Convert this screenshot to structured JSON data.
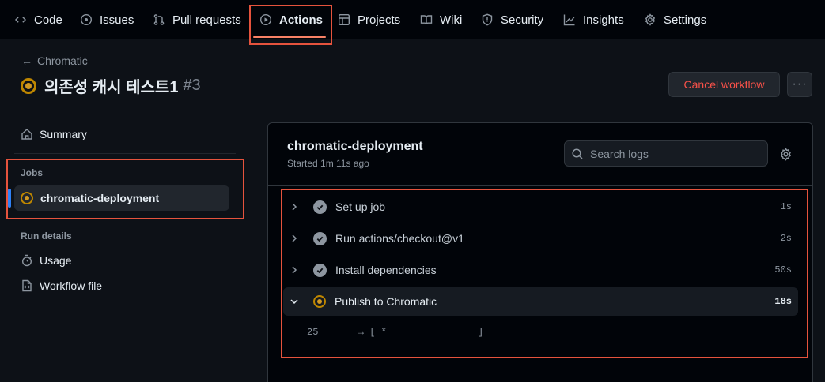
{
  "nav": {
    "tabs": [
      {
        "label": "Code",
        "icon": "code-icon"
      },
      {
        "label": "Issues",
        "icon": "issue-icon"
      },
      {
        "label": "Pull requests",
        "icon": "pull-request-icon"
      },
      {
        "label": "Actions",
        "icon": "play-icon",
        "active": true
      },
      {
        "label": "Projects",
        "icon": "table-icon"
      },
      {
        "label": "Wiki",
        "icon": "book-icon"
      },
      {
        "label": "Security",
        "icon": "shield-icon"
      },
      {
        "label": "Insights",
        "icon": "graph-icon"
      },
      {
        "label": "Settings",
        "icon": "gear-icon"
      }
    ]
  },
  "header": {
    "back_label": "Chromatic",
    "run_title": "의존성 캐시 테스트1",
    "run_number": "#3",
    "cancel_label": "Cancel workflow",
    "more_label": "···"
  },
  "sidebar": {
    "summary_label": "Summary",
    "jobs_heading": "Jobs",
    "job_name": "chromatic-deployment",
    "run_details_heading": "Run details",
    "usage_label": "Usage",
    "workflow_file_label": "Workflow file"
  },
  "job": {
    "title": "chromatic-deployment",
    "started": "Started 1m 11s ago",
    "search_placeholder": "Search logs",
    "steps": [
      {
        "name": "Set up job",
        "duration": "1s",
        "status": "success"
      },
      {
        "name": "Run actions/checkout@v1",
        "duration": "2s",
        "status": "success"
      },
      {
        "name": "Install dependencies",
        "duration": "50s",
        "status": "success"
      },
      {
        "name": "Publish to Chromatic",
        "duration": "18s",
        "status": "in_progress"
      }
    ],
    "log": {
      "line_number": "25",
      "text": "→ [ *                ]"
    }
  },
  "colors": {
    "accent_underline": "#f78166",
    "in_progress": "#d29922",
    "danger": "#f85149",
    "highlight_box": "#e5533d"
  }
}
